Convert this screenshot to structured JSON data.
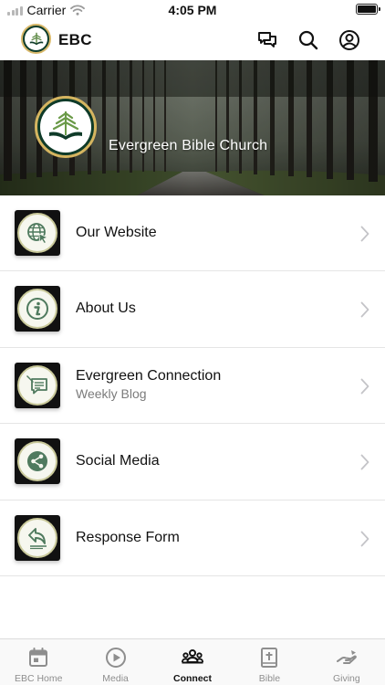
{
  "status_bar": {
    "carrier": "Carrier",
    "time": "4:05 PM"
  },
  "header": {
    "title": "EBC",
    "icons": [
      "chat-icon",
      "search-icon",
      "profile-icon"
    ]
  },
  "hero": {
    "church_name": "Evergreen Bible Church"
  },
  "menu": [
    {
      "label": "Our Website",
      "subtitle": "",
      "icon": "globe-cursor-icon"
    },
    {
      "label": "About Us",
      "subtitle": "",
      "icon": "info-icon"
    },
    {
      "label": "Evergreen Connection",
      "subtitle": "Weekly Blog",
      "icon": "blog-chat-icon"
    },
    {
      "label": "Social Media",
      "subtitle": "",
      "icon": "share-icon"
    },
    {
      "label": "Response Form",
      "subtitle": "",
      "icon": "reply-arrow-icon"
    }
  ],
  "tab_bar": {
    "tabs": [
      {
        "label": "EBC Home",
        "icon": "calendar-icon"
      },
      {
        "label": "Media",
        "icon": "play-icon"
      },
      {
        "label": "Connect",
        "icon": "people-icon",
        "active": true
      },
      {
        "label": "Bible",
        "icon": "bible-icon"
      },
      {
        "label": "Giving",
        "icon": "giving-hand-icon"
      }
    ]
  },
  "colors": {
    "brand_green": "#0f3b29",
    "brand_gold": "#d5b560",
    "icon_green": "#4f7a5e",
    "text_primary": "#111111",
    "text_secondary": "#7b7b7b"
  }
}
